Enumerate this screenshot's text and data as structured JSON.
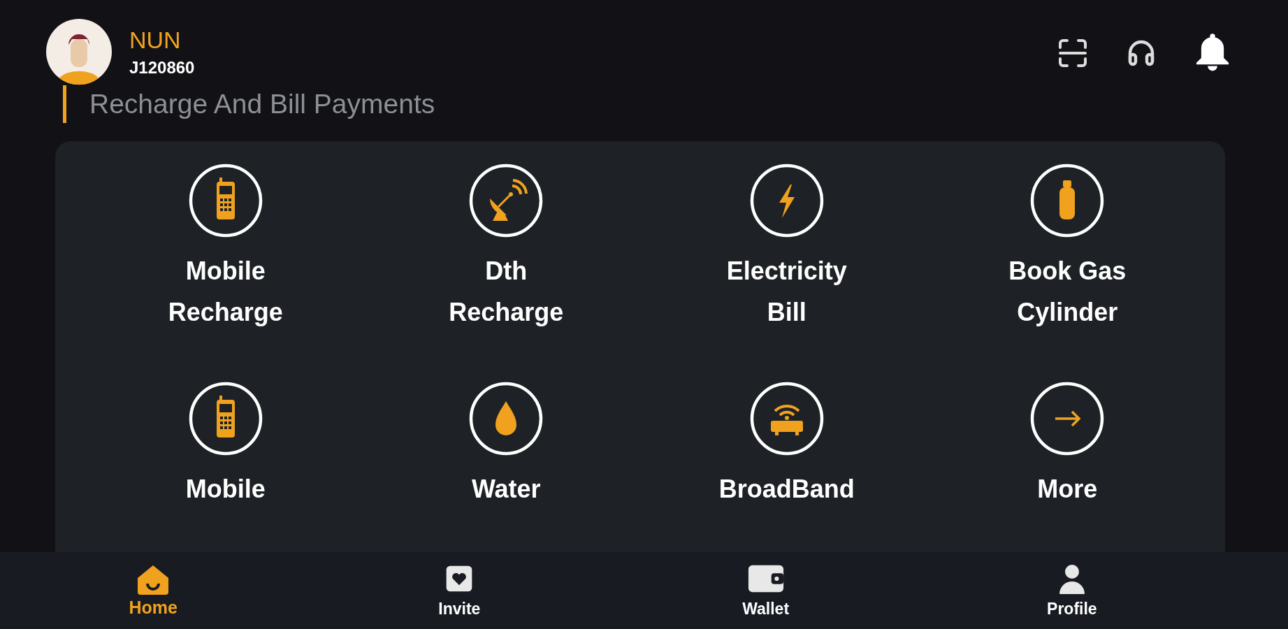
{
  "header": {
    "user": {
      "name": "NUN",
      "id": "J120860"
    },
    "actions": [
      {
        "kind": "scan"
      },
      {
        "kind": "support"
      },
      {
        "kind": "notifications"
      }
    ]
  },
  "section": {
    "title": "Recharge And Bill Payments"
  },
  "services": [
    {
      "kind": "mobile",
      "label": "Mobile Recharge"
    },
    {
      "kind": "dish",
      "label": "Dth Recharge"
    },
    {
      "kind": "bolt",
      "label": "Electricity Bill"
    },
    {
      "kind": "cylinder",
      "label": "Book Gas Cylinder"
    },
    {
      "kind": "mobile",
      "label": "Mobile"
    },
    {
      "kind": "drop",
      "label": "Water"
    },
    {
      "kind": "router",
      "label": "BroadBand"
    },
    {
      "kind": "arrow",
      "label": "More"
    }
  ],
  "bottom_nav": [
    {
      "kind": "home",
      "label": "Home",
      "selected": true
    },
    {
      "kind": "invite",
      "label": "Invite",
      "selected": false
    },
    {
      "kind": "wallet",
      "label": "Wallet",
      "selected": false
    },
    {
      "kind": "profile",
      "label": "Profile",
      "selected": false
    }
  ]
}
